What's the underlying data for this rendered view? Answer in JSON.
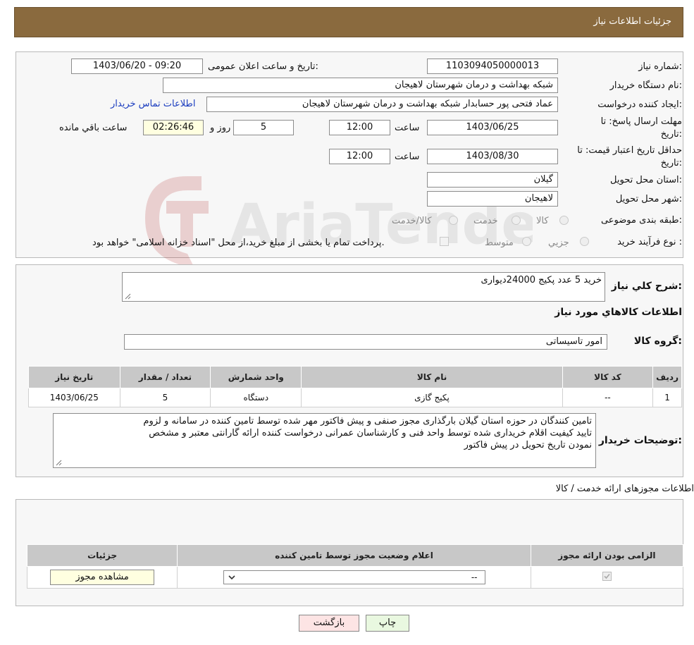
{
  "header": {
    "title": "جزئیات اطلاعات نیاز"
  },
  "watermark": {
    "text": "AriaTender.neT"
  },
  "fields": {
    "need_number_label": "شماره نیاز:",
    "need_number": "1103094050000013",
    "announce_label": "تاریخ و ساعت اعلان عمومی:",
    "announce_value": "1403/06/20 - 09:20",
    "buyer_org_label": "نام دستگاه خریدار:",
    "buyer_org": "شبکه بهداشت و درمان شهرستان لاهیجان",
    "requester_label": "ایجاد کننده درخواست:",
    "requester": "عماد فتحی پور حسابدار شبکه بهداشت و درمان شهرستان لاهیجان",
    "contact_link": "اطلاعات تماس خریدار",
    "deadline_label_1": "مهلت ارسال پاسخ: تا",
    "deadline_label_2": "تاریخ:",
    "deadline_date": "1403/06/25",
    "time_label": "ساعت",
    "deadline_time": "12:00",
    "days_value": "5",
    "days_label": "روز و",
    "remaining_time": "02:26:46",
    "remaining_label": "ساعت باقي مانده",
    "validity_label_1": "حداقل تاریخ اعتبار قیمت: تا",
    "validity_label_2": "تاریخ:",
    "validity_date": "1403/08/30",
    "validity_time": "12:00",
    "province_label": "استان محل تحویل:",
    "province": "گیلان",
    "city_label": "شهر محل تحویل:",
    "city": "لاهیجان",
    "category_label": "طبقه بندی موضوعی:",
    "category_options": [
      "کالا",
      "خدمت",
      "کالا/خدمت"
    ],
    "process_label": "نوع فرآیند خرید :",
    "process_options": [
      "جزیي",
      "متوسط"
    ],
    "process_note": "پرداخت تمام یا بخشی از مبلغ خرید،از محل \"اسناد خزانه اسلامی\" خواهد بود."
  },
  "description": {
    "label": "شرح کلي نياز:",
    "value": "خرید 5 عدد پکیج 24000دیواری"
  },
  "goods": {
    "title": "اطلاعات کالاهاي مورد نياز",
    "group_label": "گروه کالا:",
    "group_value": "امور تاسیساتی",
    "headers": [
      "ردیف",
      "کد کالا",
      "نام کالا",
      "واحد شمارش",
      "تعداد / مقدار",
      "تاریخ نیاز"
    ],
    "rows": [
      [
        "1",
        "--",
        "پکیج گازی",
        "دستگاه",
        "5",
        "1403/06/25"
      ]
    ]
  },
  "buyer_notes": {
    "label": "توضیحات خریدار:",
    "lines": [
      "تامین کنندگان  در حوزه استان گیلان  بارگذاری مجوز صنفی  و پیش فاکتور مهر شده توسط تامین کننده در سامانه و لزوم",
      "تایید کیفیت اقلام خریداری شده توسط واحد  فنی و کارشناسان عمرانی  درخواست کننده ارائه گارانتی معتبر و مشخص",
      "نمودن تاریخ تحویل در پیش فاکتور"
    ]
  },
  "licenses": {
    "title": "اطلاعات مجوزهای ارائه خدمت / کالا",
    "headers": [
      "الزامی بودن ارائه مجوز",
      "اعلام وضعیت مجوز توسط تامین کننده",
      "جزئیات"
    ],
    "select_value": "--",
    "view_button": "مشاهده مجوز"
  },
  "buttons": {
    "print": "چاپ",
    "back": "بازگشت"
  },
  "colors": {
    "header_bg": "#8a6a3e",
    "link": "#1a3cbf",
    "back_btn_bg": "#fde4e4",
    "print_btn_bg": "#e9f8e0"
  }
}
